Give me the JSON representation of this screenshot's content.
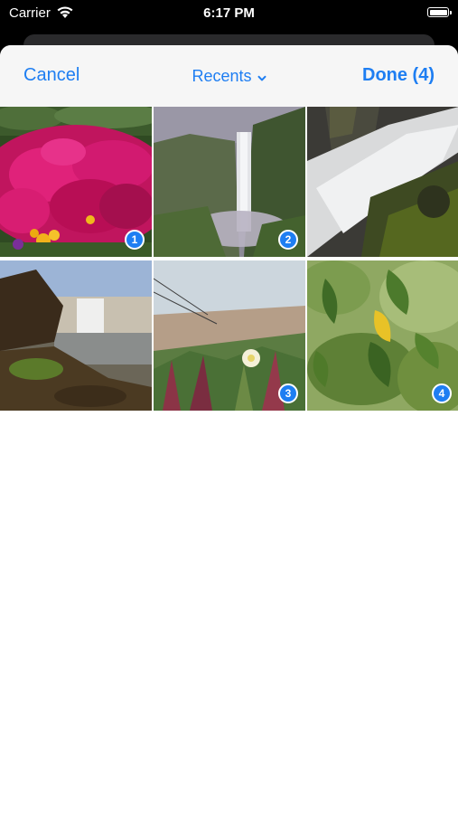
{
  "status_bar": {
    "carrier": "Carrier",
    "time": "6:17 PM"
  },
  "nav": {
    "cancel_label": "Cancel",
    "album_label": "Recents",
    "done_label": "Done (4)"
  },
  "accent_color": "#1e7ef2",
  "photos": [
    {
      "subject": "pink flowers",
      "selection_number": "1"
    },
    {
      "subject": "waterfall cliff",
      "selection_number": "2"
    },
    {
      "subject": "waterfall rocks"
    },
    {
      "subject": "waterfall coast"
    },
    {
      "subject": "beach grass flower",
      "selection_number": "3"
    },
    {
      "subject": "green leaves",
      "selection_number": "4"
    }
  ]
}
